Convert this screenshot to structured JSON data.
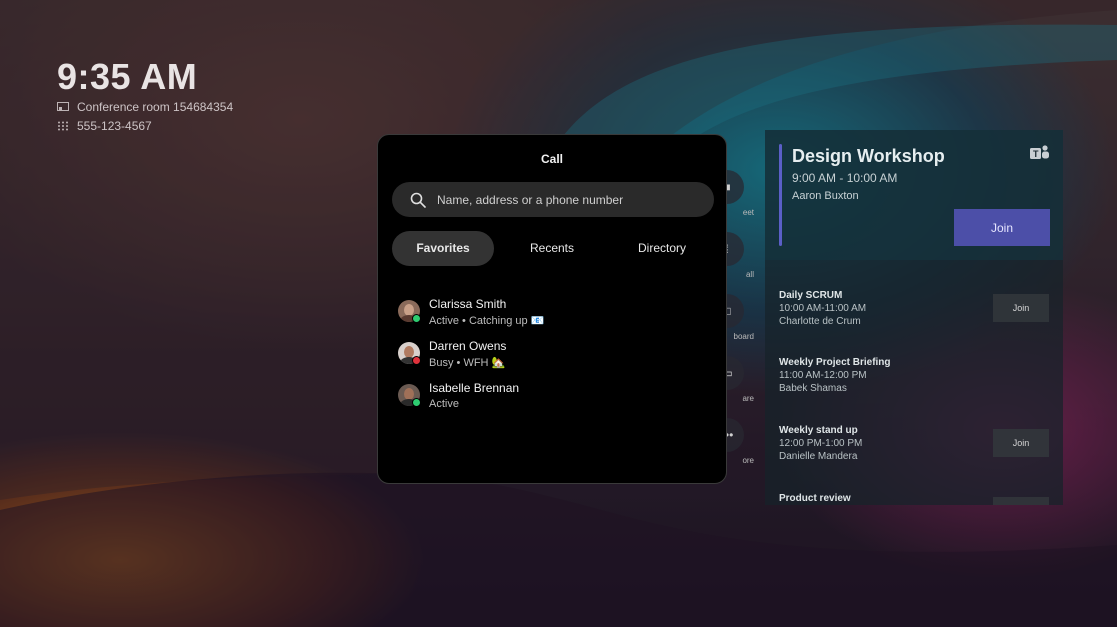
{
  "home": {
    "time": "9:35 AM",
    "room": "Conference room 154684354",
    "phone": "555-123-4567"
  },
  "side_actions": [
    {
      "label": "eet",
      "icon": "video-icon"
    },
    {
      "label": "all",
      "icon": "dialpad-icon"
    },
    {
      "label": "board",
      "icon": "whiteboard-icon"
    },
    {
      "label": "are",
      "icon": "share-screen-icon"
    },
    {
      "label": "ore",
      "icon": "more-icon"
    }
  ],
  "meetings": {
    "current": {
      "title": "Design Workshop",
      "time": "9:00 AM - 10:00 AM",
      "host": "Aaron Buxton",
      "join_label": "Join"
    },
    "list": [
      {
        "title": "Daily SCRUM",
        "time": "10:00 AM-11:00 AM",
        "host": "Charlotte de Crum",
        "join_label": "Join"
      },
      {
        "title": "Weekly Project Briefing",
        "time": "11:00 AM-12:00 PM",
        "host": "Babek Shamas",
        "join_label": ""
      },
      {
        "title": "Weekly stand up",
        "time": "12:00 PM-1:00 PM",
        "host": "Danielle Mandera",
        "join_label": "Join"
      },
      {
        "title": "Product review",
        "time": "",
        "host": "",
        "join_label": ""
      }
    ]
  },
  "call": {
    "title": "Call",
    "search_placeholder": "Name, address or a phone number",
    "tabs": [
      {
        "label": "Favorites",
        "active": true
      },
      {
        "label": "Recents",
        "active": false
      },
      {
        "label": "Directory",
        "active": false
      }
    ],
    "contacts": [
      {
        "name": "Clarissa Smith",
        "presence": "Active",
        "note": "Catching up 📧",
        "presence_color": "#2ecc71"
      },
      {
        "name": "Darren Owens",
        "presence": "Busy",
        "note": "WFH 🏡",
        "presence_color": "#e0323c"
      },
      {
        "name": "Isabelle Brennan",
        "presence": "Active",
        "note": "",
        "presence_color": "#2ecc71"
      }
    ]
  },
  "colors": {
    "accent": "#5b5fc7",
    "join_button": "#4c4fa8",
    "modal_bg": "#000000"
  }
}
